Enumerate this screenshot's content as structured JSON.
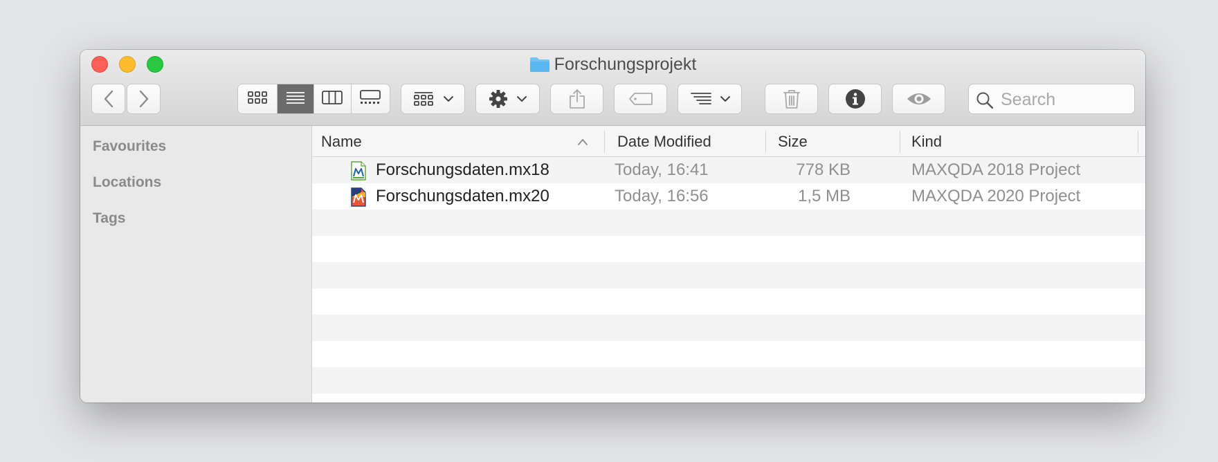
{
  "window": {
    "title": "Forschungsprojekt"
  },
  "toolbar": {
    "search_placeholder": "Search"
  },
  "sidebar": {
    "sections": [
      "Favourites",
      "Locations",
      "Tags"
    ]
  },
  "columns": {
    "name": "Name",
    "date_modified": "Date Modified",
    "size": "Size",
    "kind": "Kind"
  },
  "files": [
    {
      "name": "Forschungsdaten.mx18",
      "date": "Today, 16:41",
      "size": "778 KB",
      "kind": "MAXQDA 2018 Project"
    },
    {
      "name": "Forschungsdaten.mx20",
      "date": "Today, 16:56",
      "size": "1,5 MB",
      "kind": "MAXQDA 2020 Project"
    }
  ],
  "colors": {
    "close": "#fe5f57",
    "minimize": "#febc2e",
    "maximize": "#28c840",
    "folder": "#5ab7ef",
    "active_segment": "#6b6b6b"
  }
}
